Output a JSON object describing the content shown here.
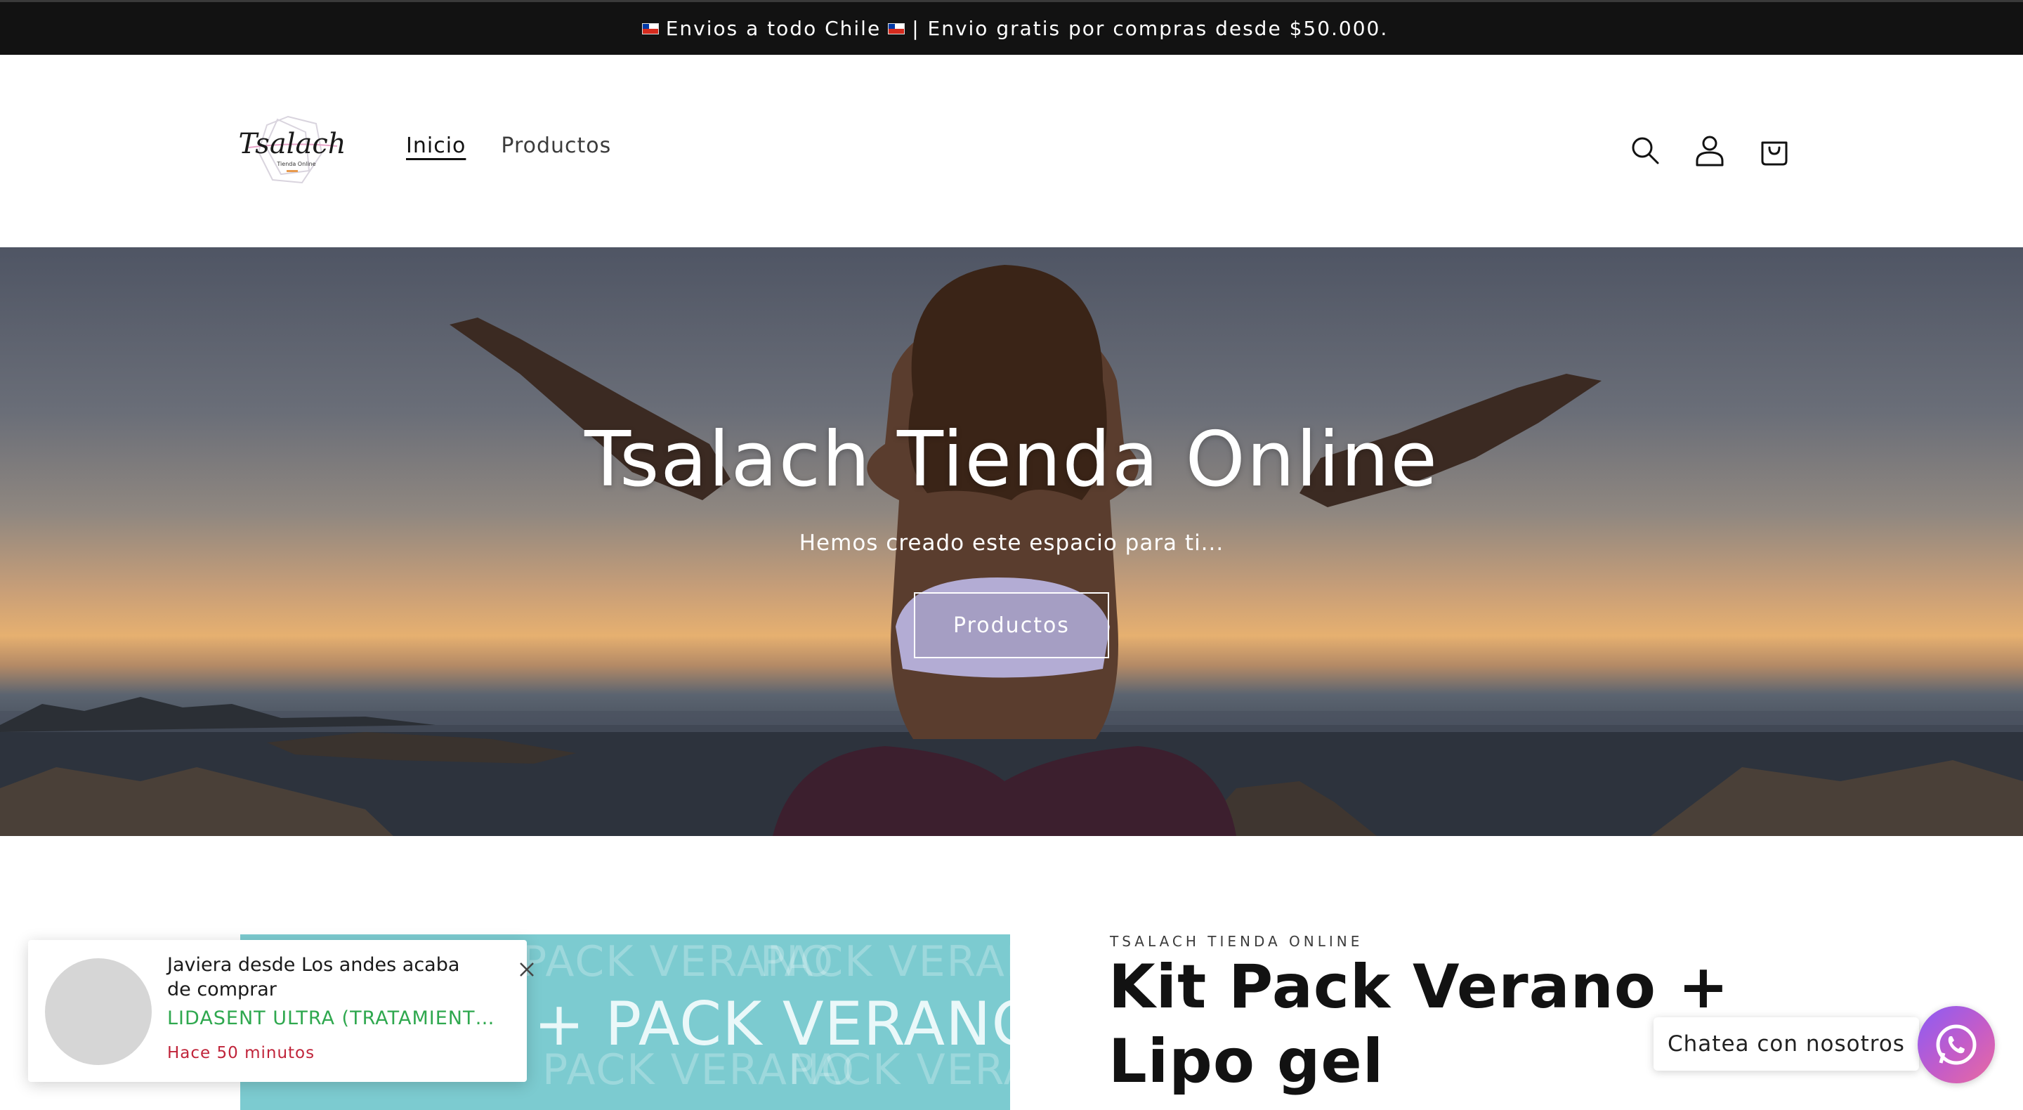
{
  "announcement": {
    "text_before": "Envios a todo Chile",
    "text_after": "| Envio gratis por compras desde $50.000."
  },
  "header": {
    "logo_text": "Tsalach",
    "logo_subtext": "Tienda Online",
    "nav": [
      {
        "label": "Inicio",
        "active": true
      },
      {
        "label": "Productos",
        "active": false
      }
    ],
    "icons": [
      "search-icon",
      "account-icon",
      "cart-icon"
    ]
  },
  "hero": {
    "title": "Tsalach Tienda Online",
    "subtitle": "Hemos creado este espacio para ti...",
    "button_label": "Productos"
  },
  "featured_product": {
    "image_text": "+ PACK VERANO",
    "image_ghost_text": "PACK VERANO",
    "vendor": "TSALACH TIENDA ONLINE",
    "title": "Kit Pack Verano + Lipo gel"
  },
  "sales_popup": {
    "message": "Javiera desde Los andes acaba de comprar",
    "product": "LIDASENT ULTRA (TRATAMIENTO...",
    "time": "Hace 50 minutos"
  },
  "chat": {
    "label": "Chatea con nosotros"
  },
  "colors": {
    "announcement_bg": "#121212",
    "popup_product": "#2fa84f",
    "popup_time": "#c0243a",
    "product_image_bg": "#7ccbd0"
  }
}
